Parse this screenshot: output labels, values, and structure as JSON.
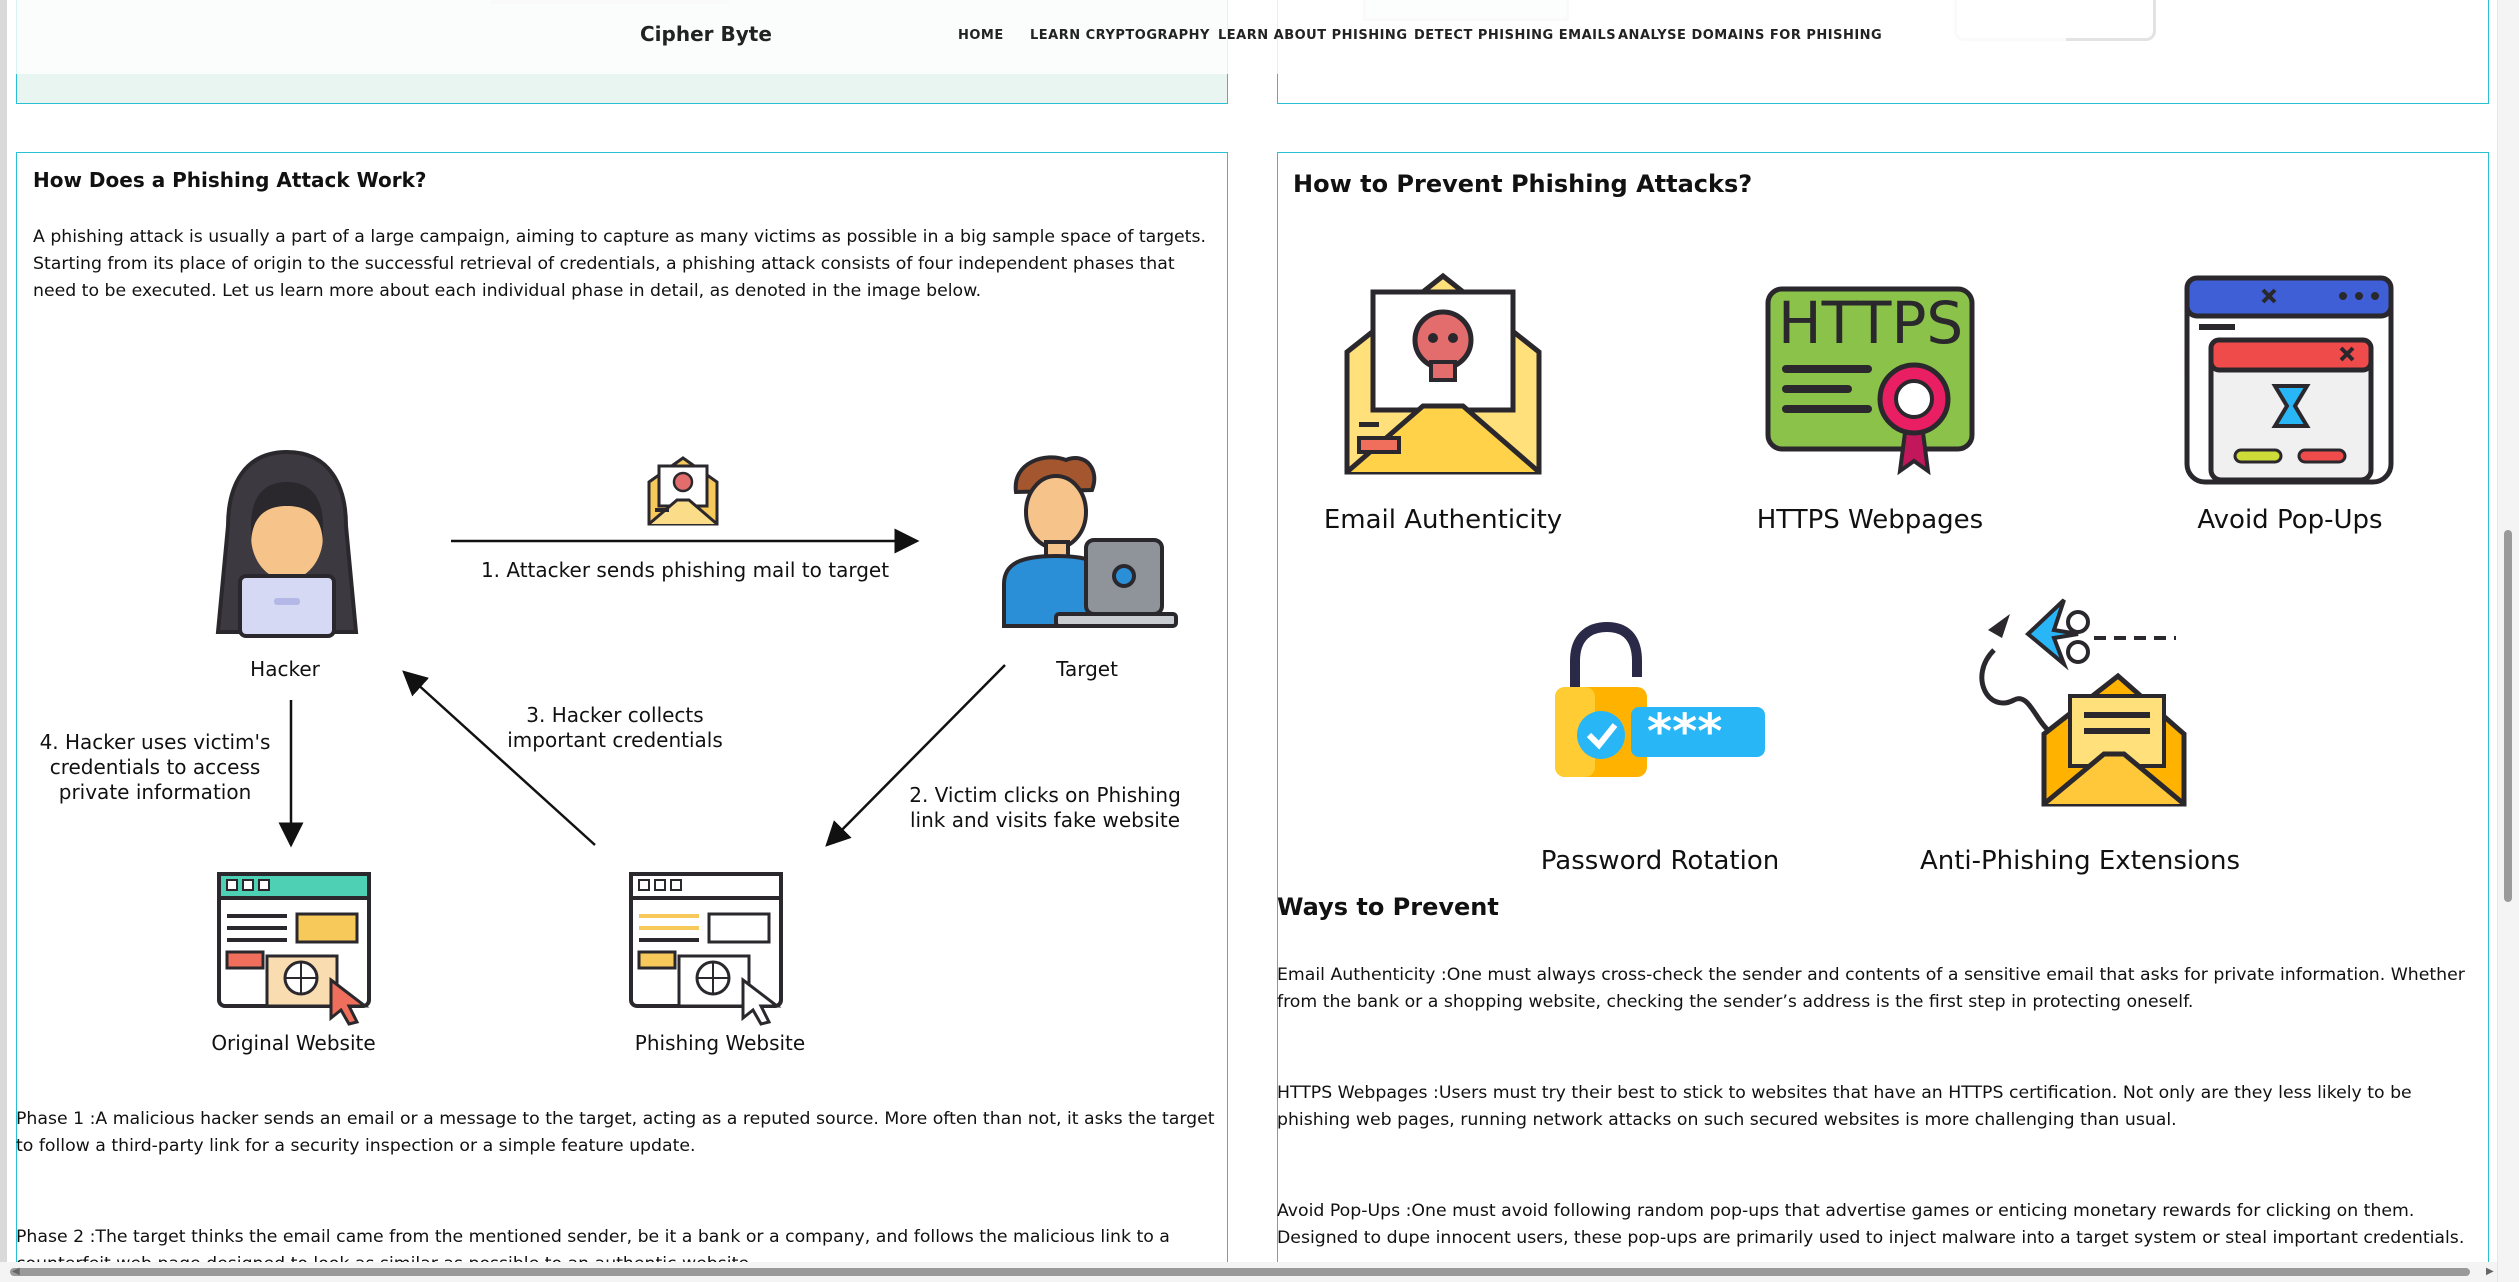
{
  "nav": {
    "brand": "Cipher Byte",
    "items": [
      "HOME",
      "LEARN CRYPTOGRAPHY",
      "LEARN ABOUT PHISHING",
      "DETECT PHISHING EMAILS",
      "ANALYSE DOMAINS FOR PHISHING"
    ]
  },
  "left": {
    "heading": "How Does a Phishing Attack Work?",
    "intro": "A phishing attack is usually a part of a large campaign, aiming to capture as many victims as possible in a big sample space of targets. Starting from its place of origin to the successful retrieval of credentials, a phishing attack consists of four independent phases that need to be executed. Let us learn more about each individual phase in detail, as denoted in the image below.",
    "diagram": {
      "hacker": "Hacker",
      "target": "Target",
      "original_website": "Original Website",
      "phishing_website": "Phishing Website",
      "step1": "1. Attacker sends phishing mail to target",
      "step2": "2. Victim clicks on Phishing link and visits fake website",
      "step3": "3. Hacker collects important credentials",
      "step4": "4. Hacker uses victim's credentials to access private information"
    },
    "phase1": "Phase 1 :A malicious hacker sends an email or a message to the target, acting as a reputed source. More often than not, it asks the target to follow a third-party link for a security inspection or a simple feature update.",
    "phase2": "Phase 2 :The target thinks the email came from the mentioned sender, be it a bank or a company, and follows the malicious link to a counterfeit web page designed to look as similar as possible to an authentic website."
  },
  "right": {
    "heading": "How to Prevent Phishing Attacks?",
    "methods": [
      "Email Authenticity",
      "HTTPS Webpages",
      "Avoid Pop-Ups",
      "Password Rotation",
      "Anti-Phishing Extensions"
    ],
    "https_sign": "HTTPS",
    "password_mask": "***",
    "ways_heading": "Ways to Prevent",
    "way1": "Email Authenticity :One must always cross-check the sender and contents of a sensitive email that asks for private information. Whether from the bank or a shopping website, checking the sender’s address is the first step in protecting oneself.",
    "way2": "HTTPS Webpages :Users must try their best to stick to websites that have an HTTPS certification. Not only are they less likely to be phishing web pages, running network attacks on such secured websites is more challenging than usual.",
    "way3": "Avoid Pop-Ups :One must avoid following random pop-ups that advertise games or enticing monetary rewards for clicking on them. Designed to dupe innocent users, these pop-ups are primarily used to inject malware into a target system or steal important credentials."
  }
}
